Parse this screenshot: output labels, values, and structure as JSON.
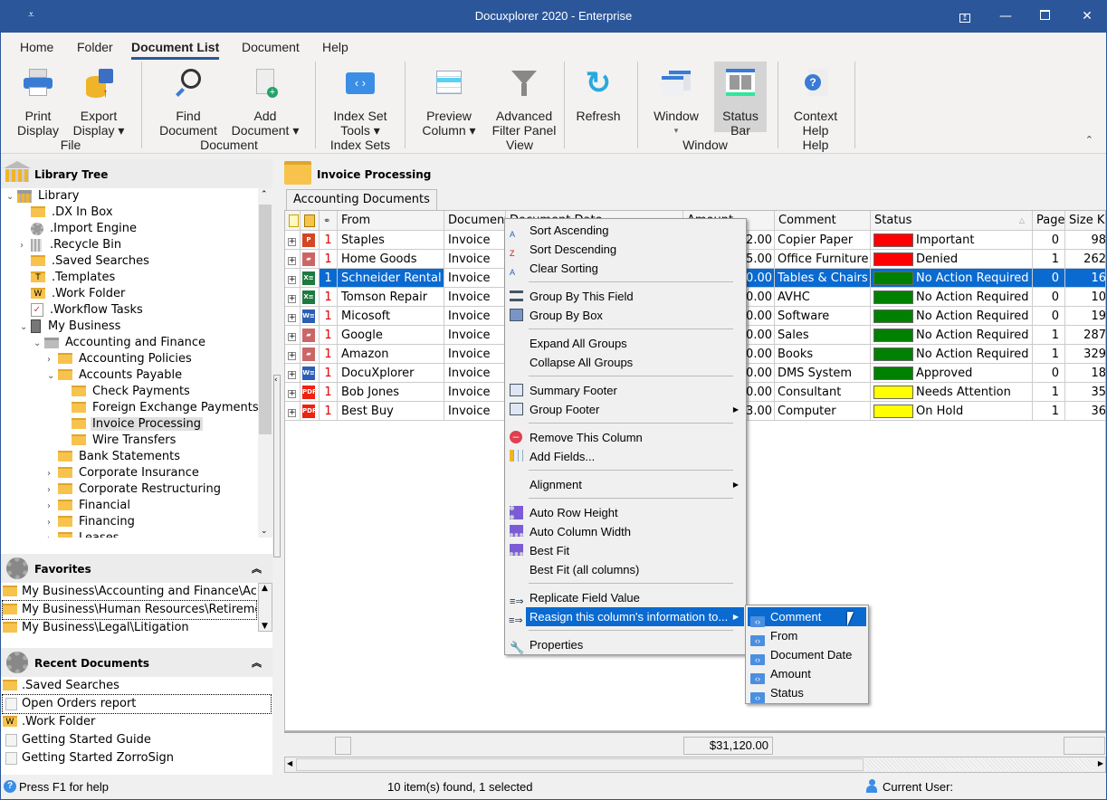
{
  "window": {
    "title": "Docuxplorer 2020 - Enterprise",
    "qat_icon": "customize-quick-access-icon",
    "controls": [
      "restore-to-tray",
      "minimize",
      "maximize",
      "close"
    ]
  },
  "menu_tabs": [
    {
      "label": "Home"
    },
    {
      "label": "Folder"
    },
    {
      "label": "Document List",
      "active": true
    },
    {
      "label": "Document"
    },
    {
      "label": "Help"
    }
  ],
  "ribbon": {
    "buttons": [
      {
        "id": "print-display",
        "line1": "Print",
        "line2": "Display"
      },
      {
        "id": "export-display",
        "line1": "Export",
        "line2": "Display ▾"
      },
      {
        "id": "find-document",
        "line1": "Find",
        "line2": "Document"
      },
      {
        "id": "add-document",
        "line1": "Add",
        "line2": "Document ▾"
      },
      {
        "id": "index-set-tools",
        "line1": "Index Set",
        "line2": "Tools ▾"
      },
      {
        "id": "preview-column",
        "line1": "Preview",
        "line2": "Column ▾"
      },
      {
        "id": "advanced-filter-panel",
        "line1": "Advanced",
        "line2": "Filter Panel"
      },
      {
        "id": "refresh",
        "line1": "Refresh",
        "line2": ""
      },
      {
        "id": "window",
        "line1": "Window",
        "line2": "▾"
      },
      {
        "id": "status-bar",
        "line1": "Status",
        "line2": "Bar",
        "pressed": true
      },
      {
        "id": "context-help",
        "line1": "Context",
        "line2": "Help"
      }
    ],
    "groups": [
      "File",
      "Document",
      "Index Sets",
      "View",
      "Window",
      "Help"
    ]
  },
  "library_tree": {
    "title": "Library Tree",
    "items": [
      {
        "label": "Library",
        "expanded": true
      },
      {
        "label": ".DX In Box"
      },
      {
        "label": ".Import Engine"
      },
      {
        "label": ".Recycle Bin",
        "expandable": true
      },
      {
        "label": ".Saved Searches"
      },
      {
        "label": ".Templates"
      },
      {
        "label": ".Work Folder"
      },
      {
        "label": ".Workflow Tasks"
      },
      {
        "label": "My Business",
        "expanded": true
      },
      {
        "label": "Accounting and Finance",
        "expanded": true
      },
      {
        "label": "Accounting Policies",
        "expandable": true
      },
      {
        "label": "Accounts Payable",
        "expanded": true
      },
      {
        "label": "Check Payments"
      },
      {
        "label": "Foreign Exchange Payments"
      },
      {
        "label": "Invoice Processing",
        "selected": true
      },
      {
        "label": "Wire Transfers"
      },
      {
        "label": "Bank Statements"
      },
      {
        "label": "Corporate Insurance",
        "expandable": true
      },
      {
        "label": "Corporate Restructuring",
        "expandable": true
      },
      {
        "label": "Financial",
        "expandable": true
      },
      {
        "label": "Financing",
        "expandable": true
      },
      {
        "label": "Leases",
        "expandable": true
      }
    ]
  },
  "favorites": {
    "title": "Favorites",
    "items": [
      {
        "label": "My Business\\Accounting and Finance\\Accounts Payable"
      },
      {
        "label": "My Business\\Human Resources\\Retirement",
        "focused": true
      },
      {
        "label": "My Business\\Legal\\Litigation"
      }
    ]
  },
  "recent_documents": {
    "title": "Recent Documents",
    "items": [
      {
        "label": ".Saved Searches",
        "icon": "saved-search-folder-icon"
      },
      {
        "label": "Open Orders report",
        "icon": "document-icon",
        "focused": true
      },
      {
        "label": ".Work Folder",
        "icon": "work-folder-icon"
      },
      {
        "label": "Getting Started Guide",
        "icon": "document-icon"
      },
      {
        "label": "Getting Started ZorroSign",
        "icon": "document-icon"
      }
    ]
  },
  "folder_header": {
    "title": "Invoice Processing"
  },
  "tabs": [
    {
      "label": "Accounting Documents",
      "active": true
    }
  ],
  "grid": {
    "columns": [
      "",
      "",
      "",
      "From",
      "Document Type",
      "Document Date",
      "Amount",
      "Comment",
      "Status",
      "Pages",
      "Size Kb"
    ],
    "rows": [
      {
        "type": "ppt",
        "count": "1",
        "from": "Staples",
        "doctype": "Invoice",
        "amount": "2.00",
        "comment": "Copier Paper",
        "status_color": "#ff0000",
        "status": "Important",
        "pages": "0",
        "size": "98"
      },
      {
        "type": "img",
        "count": "1",
        "from": "Home Goods",
        "doctype": "Invoice",
        "amount": "5.00",
        "comment": "Office Furniture",
        "status_color": "#ff0000",
        "status": "Denied",
        "pages": "1",
        "size": "262"
      },
      {
        "type": "xls",
        "count": "1",
        "from": "Schneider Rental",
        "doctype": "Invoice",
        "amount": "0.00",
        "comment": "Tables & Chairs",
        "status_color": "#008000",
        "status": "No Action Required",
        "pages": "0",
        "size": "16",
        "selected": true
      },
      {
        "type": "xls",
        "count": "1",
        "from": "Tomson Repair",
        "doctype": "Invoice",
        "amount": "0.00",
        "comment": "AVHC",
        "status_color": "#008000",
        "status": "No Action Required",
        "pages": "0",
        "size": "10"
      },
      {
        "type": "doc",
        "count": "1",
        "from": "Micosoft",
        "doctype": "Invoice",
        "amount": "0.00",
        "comment": "Software",
        "status_color": "#008000",
        "status": "No Action Required",
        "pages": "0",
        "size": "19"
      },
      {
        "type": "img",
        "count": "1",
        "from": "Google",
        "doctype": "Invoice",
        "amount": "0.00",
        "comment": "Sales",
        "status_color": "#008000",
        "status": "No Action Required",
        "pages": "1",
        "size": "287"
      },
      {
        "type": "img",
        "count": "1",
        "from": "Amazon",
        "doctype": "Invoice",
        "amount": "0.00",
        "comment": "Books",
        "status_color": "#008000",
        "status": "No Action Required",
        "pages": "1",
        "size": "329"
      },
      {
        "type": "doc",
        "count": "1",
        "from": "DocuXplorer",
        "doctype": "Invoice",
        "amount": "0.00",
        "comment": "DMS System",
        "status_color": "#008000",
        "status": "Approved",
        "pages": "0",
        "size": "18"
      },
      {
        "type": "pdf",
        "count": "1",
        "from": "Bob Jones",
        "doctype": "Invoice",
        "amount": "0.00",
        "comment": "Consultant",
        "status_color": "#ffff00",
        "status": "Needs Attention",
        "pages": "1",
        "size": "35"
      },
      {
        "type": "pdf",
        "count": "1",
        "from": "Best Buy",
        "doctype": "Invoice",
        "amount": "3.00",
        "comment": "Computer",
        "status_color": "#ffff00",
        "status": "On Hold",
        "pages": "1",
        "size": "36"
      }
    ],
    "footer_total": "$31,120.00"
  },
  "context_menu": {
    "items": [
      {
        "label": "Sort Ascending",
        "icon": "sort-ascending-icon"
      },
      {
        "label": "Sort Descending",
        "icon": "sort-descending-icon"
      },
      {
        "label": "Clear Sorting",
        "icon": ""
      },
      {
        "sep": true
      },
      {
        "label": "Group By This Field",
        "icon": "group-by-field-icon"
      },
      {
        "label": "Group By Box",
        "icon": "group-by-box-icon"
      },
      {
        "sep": true
      },
      {
        "label": "Expand All Groups",
        "icon": ""
      },
      {
        "label": "Collapse All Groups",
        "icon": ""
      },
      {
        "sep": true
      },
      {
        "label": "Summary Footer",
        "icon": "summary-footer-icon"
      },
      {
        "label": "Group Footer",
        "icon": "group-footer-icon",
        "submenu": true
      },
      {
        "sep": true
      },
      {
        "label": "Remove This Column",
        "icon": "remove-column-icon"
      },
      {
        "label": "Add Fields...",
        "icon": "add-fields-icon"
      },
      {
        "sep": true
      },
      {
        "label": "Alignment",
        "icon": "",
        "submenu": true
      },
      {
        "sep": true
      },
      {
        "label": "Auto Row Height",
        "icon": "auto-row-height-icon"
      },
      {
        "label": "Auto Column Width",
        "icon": "auto-column-width-icon"
      },
      {
        "label": "Best Fit",
        "icon": "best-fit-icon"
      },
      {
        "label": "Best Fit (all columns)",
        "icon": ""
      },
      {
        "sep": true
      },
      {
        "label": "Replicate Field Value",
        "icon": "replicate-field-icon"
      },
      {
        "label": "Reasign this column's information to...",
        "icon": "reassign-column-icon",
        "submenu": true,
        "hot": true
      },
      {
        "sep": true
      },
      {
        "label": "Properties",
        "icon": "wrench-icon"
      }
    ]
  },
  "submenu": {
    "items": [
      {
        "label": "Comment",
        "hot": true
      },
      {
        "label": "From"
      },
      {
        "label": "Document Date"
      },
      {
        "label": "Amount"
      },
      {
        "label": "Status"
      }
    ]
  },
  "statusbar": {
    "help": "Press F1 for help",
    "items_found": "10 item(s) found, 1 selected",
    "current_user": "Current User:"
  }
}
